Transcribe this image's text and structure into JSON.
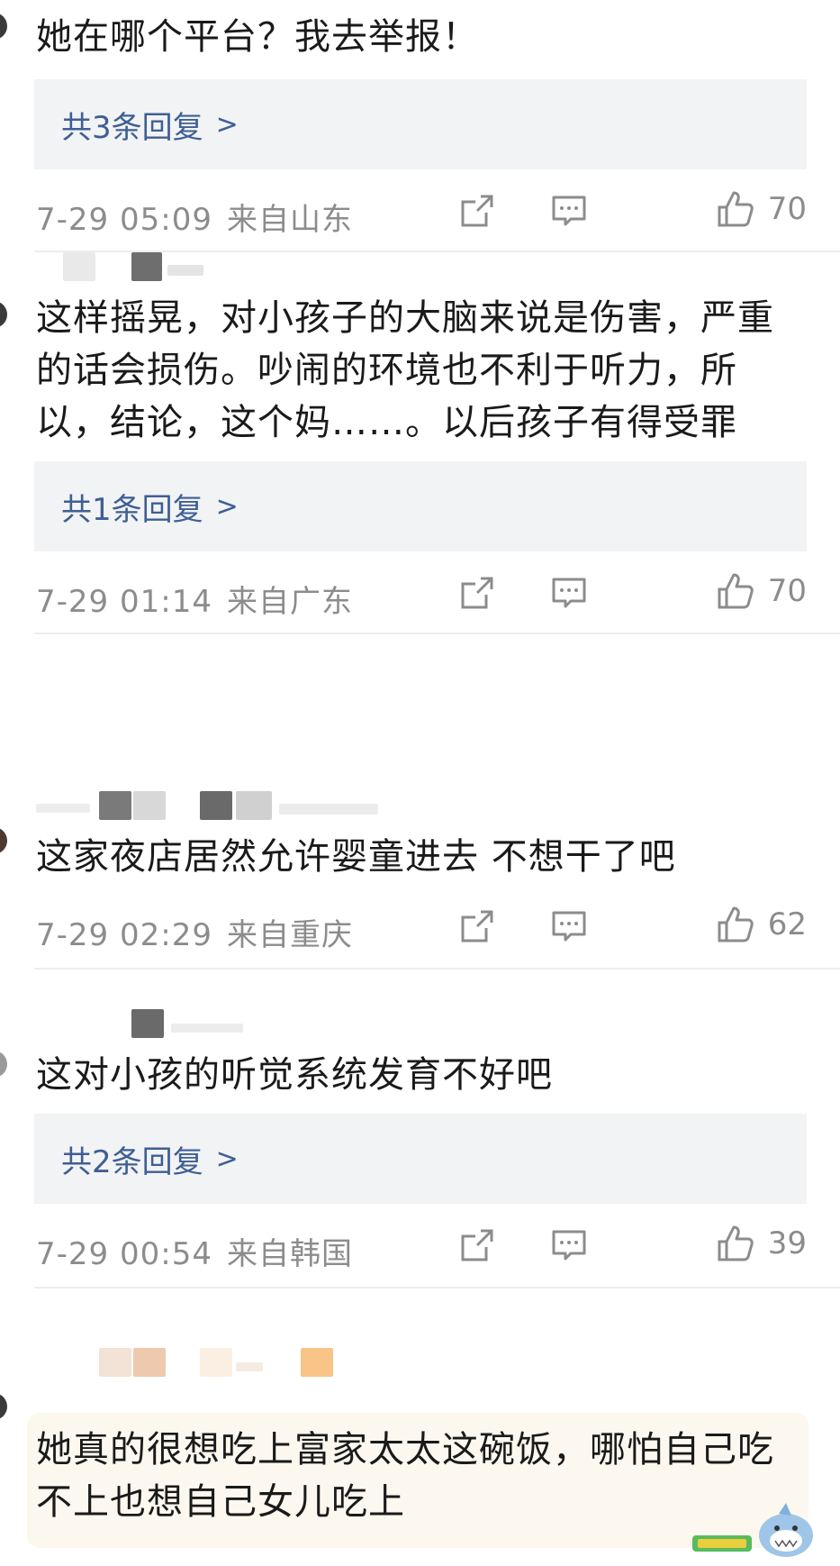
{
  "comments": [
    {
      "text": "她在哪个平台？我去举报！",
      "reply_label": "共3条回复",
      "date": "7-29 05:09",
      "location": "来自山东",
      "likes": "70"
    },
    {
      "text": "这样摇晃，对小孩子的大脑来说是伤害，严重的话会损伤。吵闹的环境也不利于听力，所以，结论，这个妈……。以后孩子有得受罪",
      "reply_label": "共1条回复",
      "date": "7-29 01:14",
      "location": "来自广东",
      "likes": "70"
    },
    {
      "text": "这家夜店居然允许婴童进去 不想干了吧",
      "date": "7-29 02:29",
      "location": "来自重庆",
      "likes": "62"
    },
    {
      "text": "这对小孩的听觉系统发育不好吧",
      "reply_label": "共2条回复",
      "date": "7-29 00:54",
      "location": "来自韩国",
      "likes": "39"
    },
    {
      "text": "她真的很想吃上富家太太这碗饭，哪怕自己吃不上也想自己女儿吃上"
    }
  ],
  "icons": {
    "share": "share-icon",
    "comment": "comment-icon",
    "like": "thumbs-up-icon",
    "chevron": "chevron-right-icon"
  },
  "colors": {
    "reply_link": "#3e5f93",
    "meta_text": "#8c8c8c",
    "reply_bg": "#f2f3f5"
  }
}
